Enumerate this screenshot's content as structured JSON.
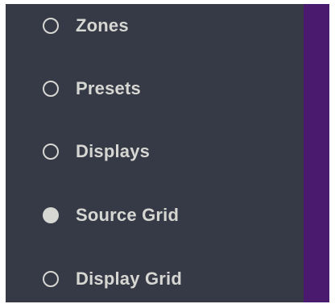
{
  "nav": {
    "items": [
      {
        "label": "Zones",
        "selected": false
      },
      {
        "label": "Presets",
        "selected": false
      },
      {
        "label": "Displays",
        "selected": false
      },
      {
        "label": "Source Grid",
        "selected": true
      },
      {
        "label": "Display Grid",
        "selected": false
      }
    ]
  },
  "colors": {
    "sidebar_bg": "#363a46",
    "accent_strip": "#4a1a6e",
    "text": "#d6d6d2"
  }
}
